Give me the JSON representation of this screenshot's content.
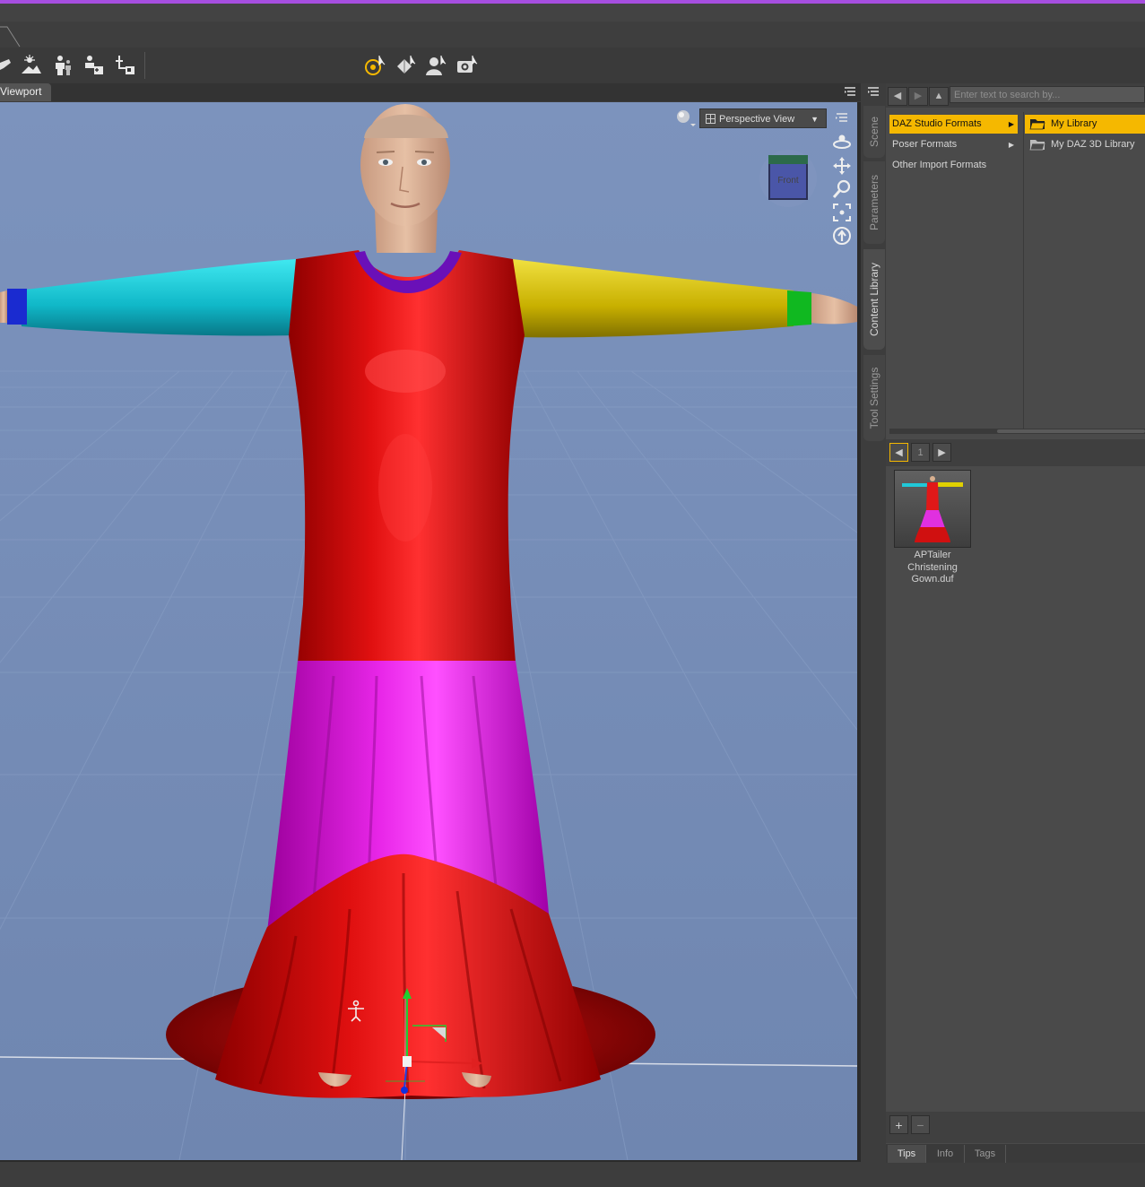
{
  "colors": {
    "accent": "#f5b800",
    "title_line": "#a64ee0",
    "viewport_bg": "#7289b4",
    "panel_bg": "#4a4a4a"
  },
  "toolbar": {
    "left_tools": [
      "pointer-icon",
      "scene-light-icon",
      "figure-icon",
      "merge-icon",
      "import-icon"
    ],
    "center_tools": [
      "universal-tool-icon",
      "joint-editor-icon",
      "figure-select-icon",
      "camera-icon"
    ]
  },
  "viewport": {
    "tab_label": "Viewport",
    "view_select": "Perspective View",
    "cube_label": "Front",
    "nav_tools": [
      "orbit-icon",
      "pan-icon",
      "zoom-icon",
      "frame-icon",
      "reset-icon"
    ]
  },
  "side_tabs": [
    "Scene",
    "Parameters",
    "Content Library",
    "Tool Settings"
  ],
  "content_library": {
    "search_placeholder": "Enter text to search by...",
    "formats": [
      {
        "label": "DAZ Studio Formats",
        "selected": true,
        "has_submenu": true
      },
      {
        "label": "Poser Formats",
        "selected": false,
        "has_submenu": true
      },
      {
        "label": "Other Import Formats",
        "selected": false,
        "has_submenu": false
      }
    ],
    "libraries": [
      {
        "label": "My Library",
        "selected": true
      },
      {
        "label": "My DAZ 3D Library",
        "selected": false
      }
    ],
    "page": "1",
    "item": {
      "line1": "APTailer",
      "line2": "Christening",
      "line3": "Gown.duf"
    },
    "add_label": "+",
    "remove_label": "−"
  },
  "info_tabs": [
    "Tips",
    "Info",
    "Tags"
  ]
}
